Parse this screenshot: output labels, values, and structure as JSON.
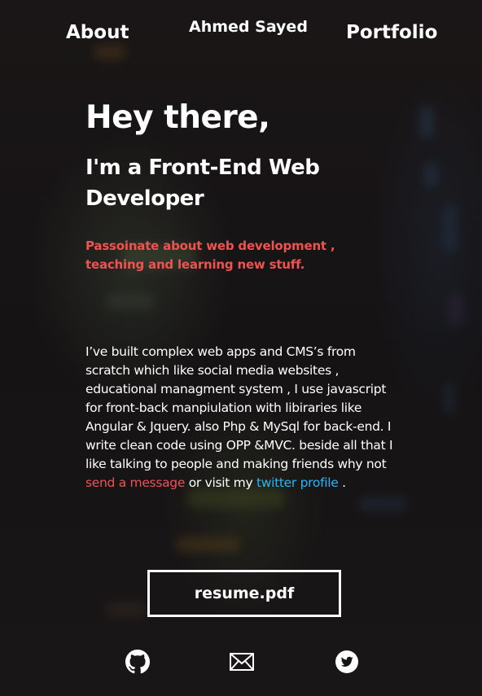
{
  "nav": {
    "about": "About",
    "name": "Ahmed Sayed",
    "portfolio": "Portfolio"
  },
  "hero": {
    "title": "Hey there,",
    "subtitle": "I'm a Front-End Web Developer",
    "tagline": "Passoinate about web development , teaching and learning new stuff."
  },
  "bio": {
    "text": "I’ve built complex web apps and CMS’s from scratch which like social media websites , educational managment system , I use javascript for front-back manpiulation with libiraries like Angular & Jquery. also Php & MySql for back-end. I write clean code using OPP &MVC. beside all that I like talking to people and making friends why not ",
    "message_link": "send a message",
    "middle": " or visit my ",
    "twitter_link": "twitter profile",
    "end": " ."
  },
  "resume": {
    "label": "resume.pdf"
  },
  "social": {
    "github_icon": "github-icon",
    "mail_icon": "mail-icon",
    "twitter_icon": "twitter-icon"
  },
  "colors": {
    "accent_red": "#ef5350",
    "accent_blue": "#29b6f6",
    "background": "#141213",
    "text": "#ffffff"
  }
}
